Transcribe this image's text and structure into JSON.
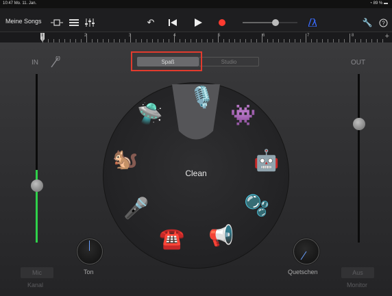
{
  "status_bar": {
    "time": "10:47",
    "date": "Mo. 11. Jan.",
    "battery": "89 %"
  },
  "toolbar": {
    "my_songs_label": "Meine Songs",
    "icons": [
      "view-toggle-icon",
      "tracks-icon",
      "mixer-icon",
      "undo-icon",
      "rewind-icon",
      "play-icon",
      "record-icon",
      "volume-slider",
      "metronome-icon",
      "settings-wrench-icon",
      "help-icon"
    ]
  },
  "ruler": {
    "bars": [
      "1",
      "2",
      "3",
      "4",
      "5",
      "6",
      "7",
      "8"
    ],
    "add_label": "+"
  },
  "mode": {
    "options": [
      "Spaß",
      "Studio"
    ],
    "selected": "Spaß"
  },
  "input": {
    "label": "IN",
    "level": 0.35
  },
  "output": {
    "label": "OUT",
    "level": 0.75
  },
  "wheel": {
    "current_effect": "Clean",
    "effects": [
      "microphone",
      "alien",
      "monster",
      "robot",
      "bubbles",
      "megaphone",
      "telephone",
      "mic-star",
      "squirrel"
    ]
  },
  "knobs": {
    "left_label": "Ton",
    "right_label": "Quetschen"
  },
  "bottom": {
    "left_button": "Mic",
    "left_sub": "Kanal",
    "right_button": "Aus",
    "right_sub": "Monitor"
  },
  "colors": {
    "accent_green": "#2fd14a",
    "record_red": "#ff3b30",
    "metronome_blue": "#3a6cff",
    "highlight_red": "#e23b2e"
  }
}
